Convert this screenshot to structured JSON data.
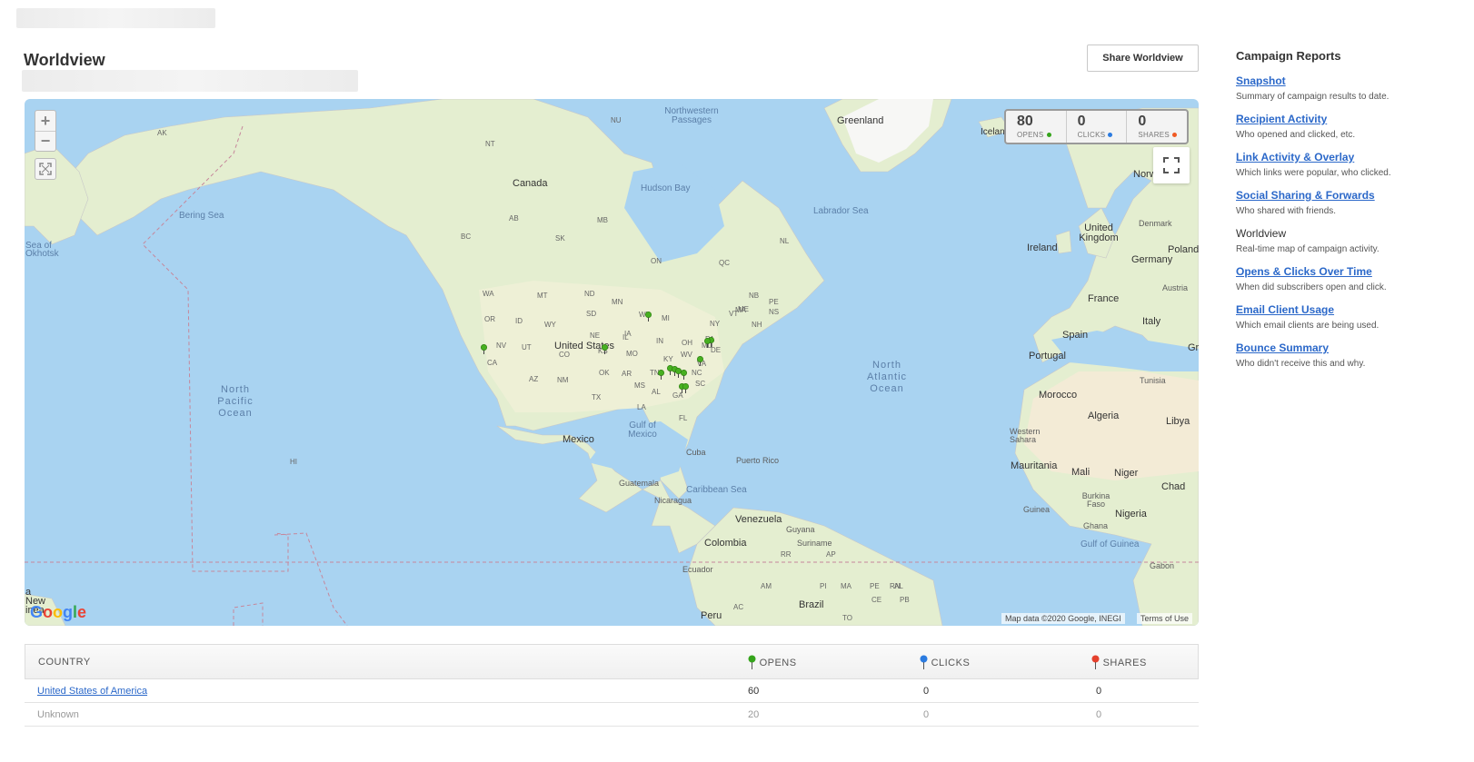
{
  "page": {
    "title": "Worldview",
    "share_button": "Share Worldview"
  },
  "map": {
    "stats": [
      {
        "value": "80",
        "label": "OPENS",
        "color": "#35a41b"
      },
      {
        "value": "0",
        "label": "CLICKS",
        "color": "#2b7be0"
      },
      {
        "value": "0",
        "label": "SHARES",
        "color": "#f05a24"
      }
    ],
    "labels": {
      "greenland": "Greenland",
      "canada": "Canada",
      "united_states": "United States",
      "mexico": "Mexico",
      "hudson_bay": "Hudson Bay",
      "labrador_sea": "Labrador Sea",
      "bering_sea": "Bering Sea",
      "sea_of_okhotsk": "Sea of Okhotsk",
      "northwestern_passages": "Northwestern Passages",
      "north_pacific_ocean": "North Pacific Ocean",
      "north_atlantic_ocean": "North Atlantic Ocean",
      "gulf_of_mexico": "Gulf of Mexico",
      "caribbean_sea": "Caribbean Sea",
      "gulf_of_guinea": "Gulf of Guinea",
      "cuba": "Cuba",
      "puerto_rico": "Puerto Rico",
      "guatemala": "Guatemala",
      "nicaragua": "Nicaragua",
      "venezuela": "Venezuela",
      "colombia": "Colombia",
      "guyana": "Guyana",
      "suriname": "Suriname",
      "ecuador": "Ecuador",
      "peru": "Peru",
      "brazil": "Brazil",
      "norway": "Norway",
      "iceland": "Icelan",
      "united_kingdom": "United Kingdom",
      "ireland": "Ireland",
      "denmark": "Denmark",
      "germany": "Germany",
      "poland": "Poland",
      "france": "France",
      "austria": "Austria",
      "italy": "Italy",
      "spain": "Spain",
      "portugal": "Portugal",
      "greece": "Gr",
      "tunisia": "Tunisia",
      "morocco": "Morocco",
      "algeria": "Algeria",
      "libya": "Libya",
      "western_sahara": "Western Sahara",
      "mauritania": "Mauritania",
      "mali": "Mali",
      "niger": "Niger",
      "chad": "Chad",
      "burkina_faso": "Burkina Faso",
      "guinea": "Guinea",
      "ghana": "Ghana",
      "nigeria": "Nigeria",
      "gabon": "Gabon",
      "papua_new_guinea": "a New inea",
      "hi": "HI",
      "states": [
        "AK",
        "NU",
        "NT",
        "AB",
        "MB",
        "SK",
        "BC",
        "ON",
        "QC",
        "NL",
        "NB",
        "NS",
        "PE",
        "WA",
        "MT",
        "ND",
        "MN",
        "OR",
        "ID",
        "SD",
        "WI",
        "MI",
        "WY",
        "NE",
        "IA",
        "NV",
        "UT",
        "CO",
        "KS",
        "MO",
        "IL",
        "IN",
        "OH",
        "PA",
        "NY",
        "VT",
        "NH",
        "MA",
        "ME",
        "CA",
        "AZ",
        "NM",
        "OK",
        "AR",
        "KY",
        "WV",
        "VA",
        "MD",
        "DE",
        "TN",
        "NC",
        "MS",
        "AL",
        "GA",
        "SC",
        "TX",
        "LA",
        "FL",
        "RR",
        "AP",
        "AM",
        "MA",
        "PI",
        "CE",
        "RN",
        "PB",
        "AC",
        "TO",
        "PE",
        "AL"
      ]
    },
    "attribution": "Map data ©2020 Google, INEGI",
    "terms": "Terms of Use",
    "logo": "Google"
  },
  "table": {
    "headers": {
      "country": "COUNTRY",
      "opens": "OPENS",
      "clicks": "CLICKS",
      "shares": "SHARES"
    },
    "rows": [
      {
        "country": "United States of America",
        "opens": "60",
        "clicks": "0",
        "shares": "0"
      },
      {
        "country": "Unknown",
        "opens": "20",
        "clicks": "0",
        "shares": "0"
      }
    ]
  },
  "sidebar": {
    "title": "Campaign Reports",
    "items": [
      {
        "label": "Snapshot",
        "desc": "Summary of campaign results to date."
      },
      {
        "label": "Recipient Activity",
        "desc": "Who opened and clicked, etc."
      },
      {
        "label": "Link Activity & Overlay",
        "desc": "Which links were popular, who clicked."
      },
      {
        "label": "Social Sharing & Forwards",
        "desc": "Who shared with friends."
      },
      {
        "label": "Worldview",
        "desc": "Real-time map of campaign activity."
      },
      {
        "label": "Opens & Clicks Over Time",
        "desc": "When did subscribers open and click."
      },
      {
        "label": "Email Client Usage",
        "desc": "Which email clients are being used."
      },
      {
        "label": "Bounce Summary",
        "desc": "Who didn't receive this and why."
      }
    ]
  }
}
